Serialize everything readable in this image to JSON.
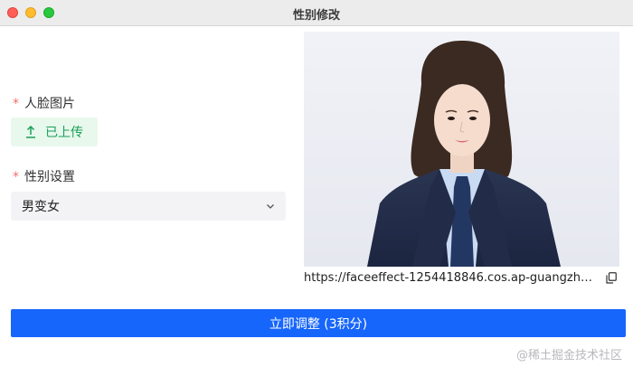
{
  "window": {
    "title": "性别修改"
  },
  "form": {
    "face_label": "人脸图片",
    "face_required_mark": "*",
    "upload_label": "已上传",
    "gender_label": "性别设置",
    "gender_required_mark": "*",
    "gender_selected": "男变女"
  },
  "preview": {
    "url": "https://faceeffect-1254418846.cos.ap-guangzho..."
  },
  "submit": {
    "label": "立即调整 (3积分)"
  },
  "watermark": "@稀土掘金技术社区",
  "colors": {
    "primary": "#1766fb",
    "success": "#18a058",
    "success_bg": "#e8f8ec",
    "required": "#f56c6c"
  },
  "icons": {
    "upload": "upload-icon",
    "chevron": "chevron-down-icon",
    "copy": "copy-icon"
  }
}
